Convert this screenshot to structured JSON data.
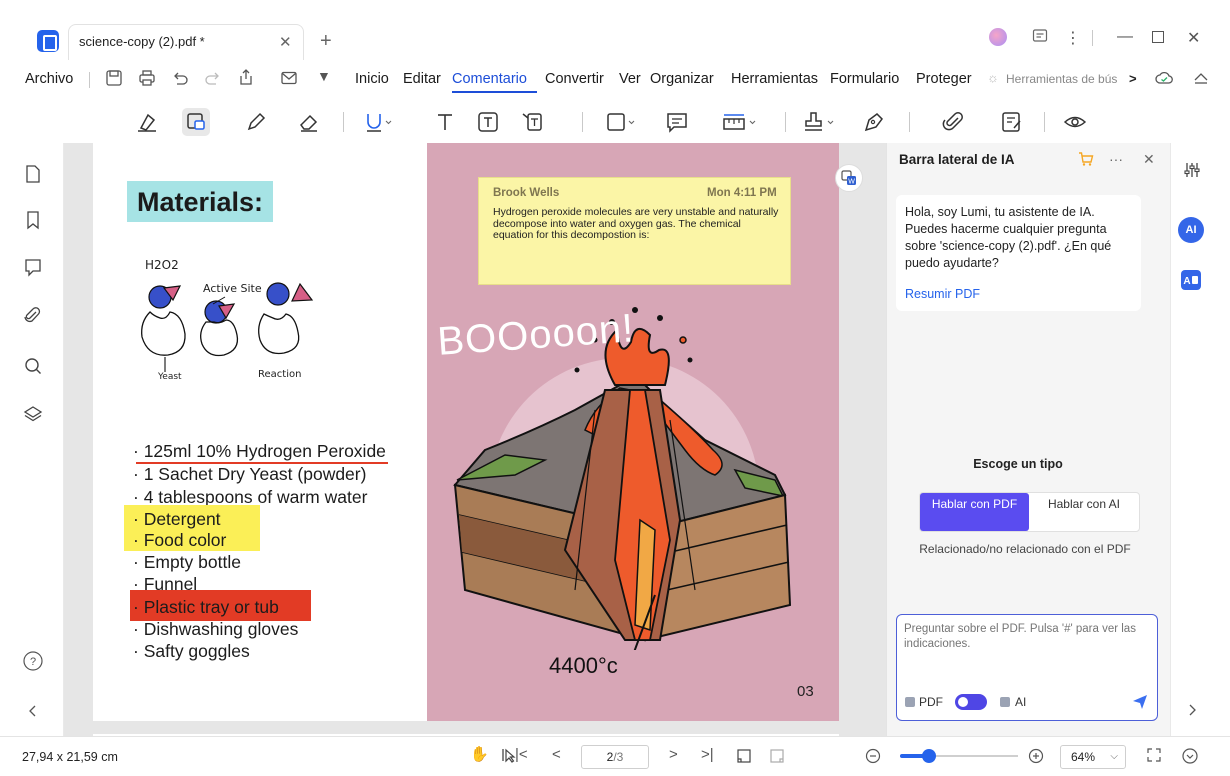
{
  "tab": {
    "title": "science-copy (2).pdf *"
  },
  "menu": {
    "file": "Archivo",
    "items": [
      "Inicio",
      "Editar",
      "Comentario",
      "Convertir",
      "Ver",
      "Organizar",
      "Herramientas",
      "Formulario",
      "Proteger"
    ],
    "active": "Comentario",
    "search_tools": "Herramientas de bús",
    "search_more": ">"
  },
  "page": {
    "materials_title": "Materials:",
    "diagram": {
      "h2o2": "H2O2",
      "active_site": "Active Site",
      "yeast": "Yeast",
      "reaction": "Reaction"
    },
    "items": [
      "· 125ml 10% Hydrogen Peroxide",
      "· 1 Sachet Dry Yeast (powder)",
      "· 4 tablespoons of warm water",
      "· Detergent",
      "· Food color",
      "· Empty bottle",
      "· Funnel",
      "· Plastic tray or tub",
      "· Dishwashing gloves",
      "· Safty goggles"
    ],
    "boo": "BOOooon!",
    "temperature": "4400°c",
    "page_number": "03"
  },
  "comment": {
    "author": "Brook Wells",
    "time": "Mon 4:11 PM",
    "text": "Hydrogen peroxide molecules are very unstable and naturally decompose into water and oxygen gas. The chemical equation for this decompostion is:"
  },
  "ai_panel": {
    "title": "Barra lateral de IA",
    "greeting": "Hola, soy Lumi, tu asistente de IA. Puedes hacerme cualquier pregunta sobre 'science-copy (2).pdf'. ¿En qué puedo ayudarte?",
    "summarize_link": "Resumir PDF",
    "choose_type": "Escoge un tipo",
    "option_pdf": "Hablar con PDF",
    "option_ai": "Hablar con AI",
    "related_note": "Relacionado/no relacionado con el PDF",
    "input_placeholder": "Preguntar sobre el PDF. Pulsa '#' para ver las indicaciones.",
    "toggle_pdf": "PDF",
    "toggle_ai": "AI",
    "ai_badge": "AI"
  },
  "status": {
    "dimensions": "27,94 x 21,59 cm",
    "page_current": "2",
    "page_total": "/3",
    "zoom": "64%"
  },
  "colors": {
    "accent": "#1d4ed8",
    "ai_purple": "#5a4cf0",
    "page_pink": "#d7a6b6",
    "highlight_yellow": "#fbef57",
    "highlight_red": "#e23b25",
    "sticky": "#fbf5a6"
  }
}
